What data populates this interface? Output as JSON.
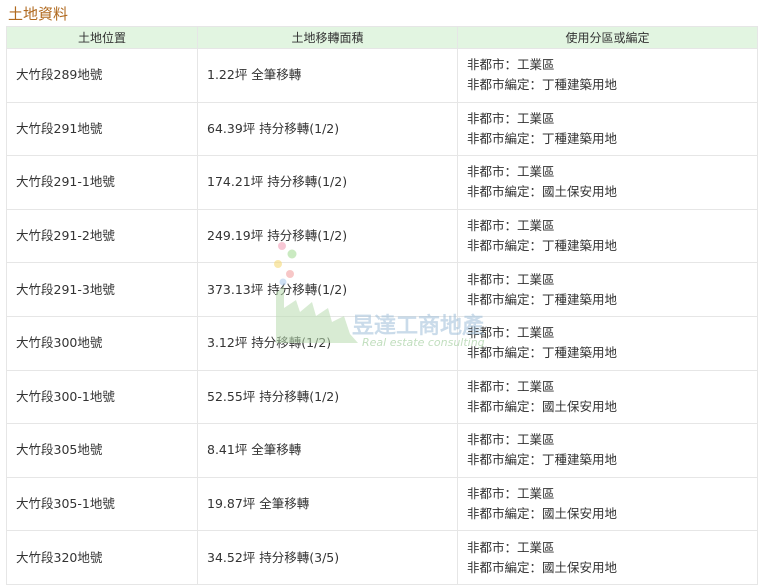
{
  "section": {
    "title": "土地資料"
  },
  "table": {
    "headers": [
      "土地位置",
      "土地移轉面積",
      "使用分區或編定"
    ],
    "rows": [
      {
        "location": "大竹段289地號",
        "area": "1.22坪 全筆移轉",
        "zone": "非都市：工業區",
        "designation": "非都市編定：丁種建築用地"
      },
      {
        "location": "大竹段291地號",
        "area": "64.39坪 持分移轉(1/2)",
        "zone": "非都市：工業區",
        "designation": "非都市編定：丁種建築用地"
      },
      {
        "location": "大竹段291-1地號",
        "area": "174.21坪 持分移轉(1/2)",
        "zone": "非都市：工業區",
        "designation": "非都市編定：國土保安用地"
      },
      {
        "location": "大竹段291-2地號",
        "area": "249.19坪 持分移轉(1/2)",
        "zone": "非都市：工業區",
        "designation": "非都市編定：丁種建築用地"
      },
      {
        "location": "大竹段291-3地號",
        "area": "373.13坪 持分移轉(1/2)",
        "zone": "非都市：工業區",
        "designation": "非都市編定：丁種建築用地"
      },
      {
        "location": "大竹段300地號",
        "area": "3.12坪 持分移轉(1/2)",
        "zone": "非都市：工業區",
        "designation": "非都市編定：丁種建築用地"
      },
      {
        "location": "大竹段300-1地號",
        "area": "52.55坪 持分移轉(1/2)",
        "zone": "非都市：工業區",
        "designation": "非都市編定：國土保安用地"
      },
      {
        "location": "大竹段305地號",
        "area": "8.41坪 全筆移轉",
        "zone": "非都市：工業區",
        "designation": "非都市編定：丁種建築用地"
      },
      {
        "location": "大竹段305-1地號",
        "area": "19.87坪 全筆移轉",
        "zone": "非都市：工業區",
        "designation": "非都市編定：國土保安用地"
      },
      {
        "location": "大竹段320地號",
        "area": "34.52坪 持分移轉(3/5)",
        "zone": "非都市：工業區",
        "designation": "非都市編定：國土保安用地"
      }
    ]
  },
  "watermark": {
    "name": "昱達工商地產",
    "sub": "Real estate consulting"
  },
  "colors": {
    "title": "#b0691e",
    "header_bg": "#e2f5e1",
    "border": "#e6e6e6"
  }
}
